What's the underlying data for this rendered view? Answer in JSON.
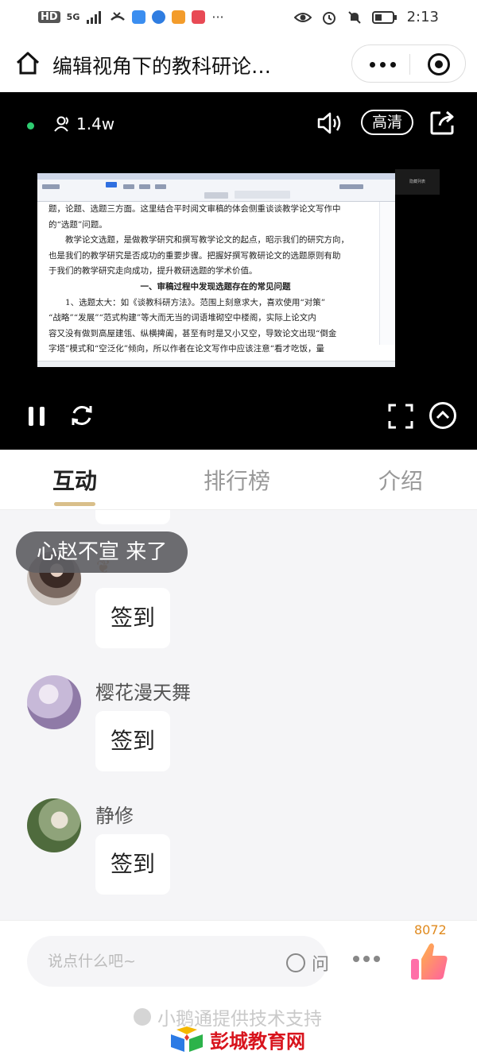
{
  "status_bar": {
    "left": [
      "HD",
      "5G"
    ],
    "more": "···",
    "time": "2:13"
  },
  "header": {
    "title": "编辑视角下的教科研论…",
    "icons": [
      "home-icon",
      "more-icon",
      "close-mini-program-icon"
    ]
  },
  "player": {
    "viewers": "1.4w",
    "quality": "高清",
    "icons": [
      "speaker-icon",
      "share-icon",
      "pause-icon",
      "refresh-icon",
      "fullscreen-icon",
      "collapse-icon"
    ],
    "screen_side_button": "隐藏列表",
    "doc_lines": [
      "题，论题、选题三方面。这里结合平时阅文审稿的体会侧重谈谈教学论文写作中",
      "的“选题”问题。",
      "　　教学论文选题，是做教学研究和撰写教学论文的起点，昭示我们的研究方向，",
      "也是我们的教学研究是否成功的重要步骤。把握好撰写教研论文的选题原则有助",
      "于我们的教学研究走向成功，提升教研选题的学术价值。",
      "一、审稿过程中发现选题存在的常见问题",
      "　　1、选题太大：如《谈教科研方法》。范围上刻意求大，喜欢使用“对策”",
      "“战略”“发展”“范式构建”等大而无当的词语堆砌空中楼阁，实际上论文内",
      "容又没有做到高屋建瓴、纵横捭阖，甚至有时是又小又空，导致论文出现“倒金",
      "字塔”模式和“空泛化”倾向，所以作者在论文写作中应该注意“看才吃饭，量"
    ]
  },
  "tabs": [
    {
      "label": "互动",
      "active": true
    },
    {
      "label": "排行榜",
      "active": false
    },
    {
      "label": "介绍",
      "active": false
    }
  ],
  "chat": {
    "join_toast": "心赵不宣 来了",
    "messages": [
      {
        "user": "",
        "text": "签到"
      },
      {
        "user": "樱花漫天舞",
        "text": "签到"
      },
      {
        "user": "静修",
        "text": "签到"
      }
    ]
  },
  "bottom": {
    "input_placeholder": "说点什么吧~",
    "ask_label": "问",
    "like_count": "8072",
    "powered_by": "小鹅通提供技术支持",
    "watermark": "彭城教育网"
  },
  "colors": {
    "accent_underline": "#d9bf8a",
    "live_dot": "#2ecc71",
    "like_count": "#e08a1e",
    "watermark": "#d8141d"
  }
}
